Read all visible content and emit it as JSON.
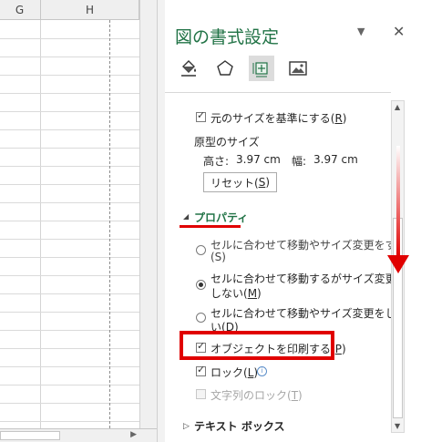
{
  "sheet": {
    "columns": [
      "G",
      "H"
    ]
  },
  "pane": {
    "title": "図の書式設定",
    "menu_icon": "dropdown-triangle-icon",
    "close_glyph": "✕",
    "tabs": [
      "fill-line-icon",
      "effects-pentagon-icon",
      "size-properties-icon",
      "picture-icon"
    ],
    "selected_tab": "size-properties-icon",
    "size_section": {
      "relative_label": "元のサイズを基準にする(",
      "relative_key": "R",
      "relative_end": ")",
      "relative_checked": true,
      "original_size_heading": "原型のサイズ",
      "height_label": "高さ:",
      "height_value": "3.97 cm",
      "width_label": "幅:",
      "width_value": "3.97 cm",
      "reset_label": "リセット(",
      "reset_key": "S",
      "reset_end": ")"
    },
    "properties_section": {
      "title": "プロパティ",
      "option1_line1": "セルに合わせて移動やサイズ変更をする",
      "option1_line2": "(S)",
      "option2_line1": "セルに合わせて移動するがサイズ変更は",
      "option2_line2_a": "しない(",
      "option2_line2_key": "M",
      "option2_line2_b": ")",
      "option2_selected": true,
      "option3_line1": "セルに合わせて移動やサイズ変更をしな",
      "option3_line2_a": "い(",
      "option3_line2_key": "D",
      "option3_line2_b": ")",
      "print_label": "オブジェクトを印刷する(",
      "print_key": "P",
      "print_end": ")",
      "print_checked": true,
      "lock_label": "ロック(",
      "lock_key": "L",
      "lock_end": ")",
      "lock_checked": true,
      "text_lock_label": "文字列のロック(",
      "text_lock_key": "T",
      "text_lock_end": ")",
      "text_lock_enabled": false
    },
    "textbox_section": {
      "title": "テキスト ボックス"
    }
  },
  "annotations": {
    "highlight_color": "#e00000"
  },
  "colors": {
    "accent": "#217346"
  }
}
